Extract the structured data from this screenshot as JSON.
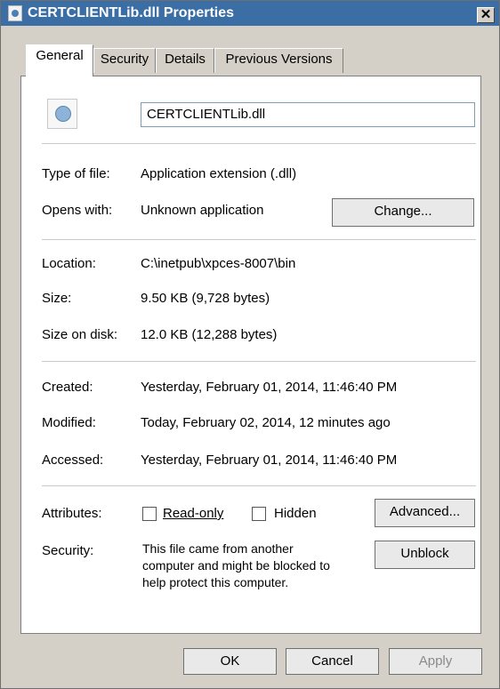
{
  "window": {
    "title": "CERTCLIENTLib.dll Properties",
    "close_glyph": "✕"
  },
  "tabs": [
    {
      "label": "General",
      "active": true
    },
    {
      "label": "Security"
    },
    {
      "label": "Details"
    },
    {
      "label": "Previous Versions"
    }
  ],
  "file": {
    "name": "CERTCLIENTLib.dll"
  },
  "labels": {
    "type_of_file": "Type of file:",
    "opens_with": "Opens with:",
    "location": "Location:",
    "size": "Size:",
    "size_on_disk": "Size on disk:",
    "created": "Created:",
    "modified": "Modified:",
    "accessed": "Accessed:",
    "attributes": "Attributes:",
    "security": "Security:"
  },
  "values": {
    "type_of_file": "Application extension (.dll)",
    "opens_with": "Unknown application",
    "location": "C:\\inetpub\\xpces-8007\\bin",
    "size": "9.50 KB (9,728 bytes)",
    "size_on_disk": "12.0 KB (12,288 bytes)",
    "created": "Yesterday, February 01, 2014, 11:46:40 PM",
    "modified": "Today, February 02, 2014, 12 minutes ago",
    "accessed": "Yesterday, February 01, 2014, 11:46:40 PM"
  },
  "attributes": {
    "readonly_label": "Read-only",
    "readonly_checked": false,
    "hidden_label": "Hidden",
    "hidden_checked": false
  },
  "security": {
    "line1": "This file came from another",
    "line2": "computer and might be blocked to",
    "line3": "help protect this computer."
  },
  "buttons": {
    "change": "Change...",
    "advanced": "Advanced...",
    "unblock": "Unblock",
    "ok": "OK",
    "cancel": "Cancel",
    "apply": "Apply"
  }
}
